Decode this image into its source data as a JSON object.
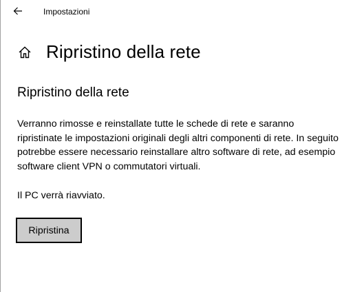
{
  "titlebar": {
    "back_icon": "back-arrow-icon",
    "app_title": "Impostazioni"
  },
  "header": {
    "home_icon": "home-icon",
    "title": "Ripristino della rete"
  },
  "main": {
    "section_title": "Ripristino della rete",
    "description": "Verranno rimosse e reinstallate tutte le schede di rete e saranno ripristinate le impostazioni originali degli altri componenti di rete. In seguito potrebbe essere necessario reinstallare altro software di rete, ad esempio software client VPN o commutatori virtuali.",
    "restart_note": "Il PC verrà riavviato.",
    "reset_button_label": "Ripristina"
  },
  "colors": {
    "background": "#ffffff",
    "text": "#000000",
    "button_background": "#cccccc",
    "button_border": "#000000"
  }
}
